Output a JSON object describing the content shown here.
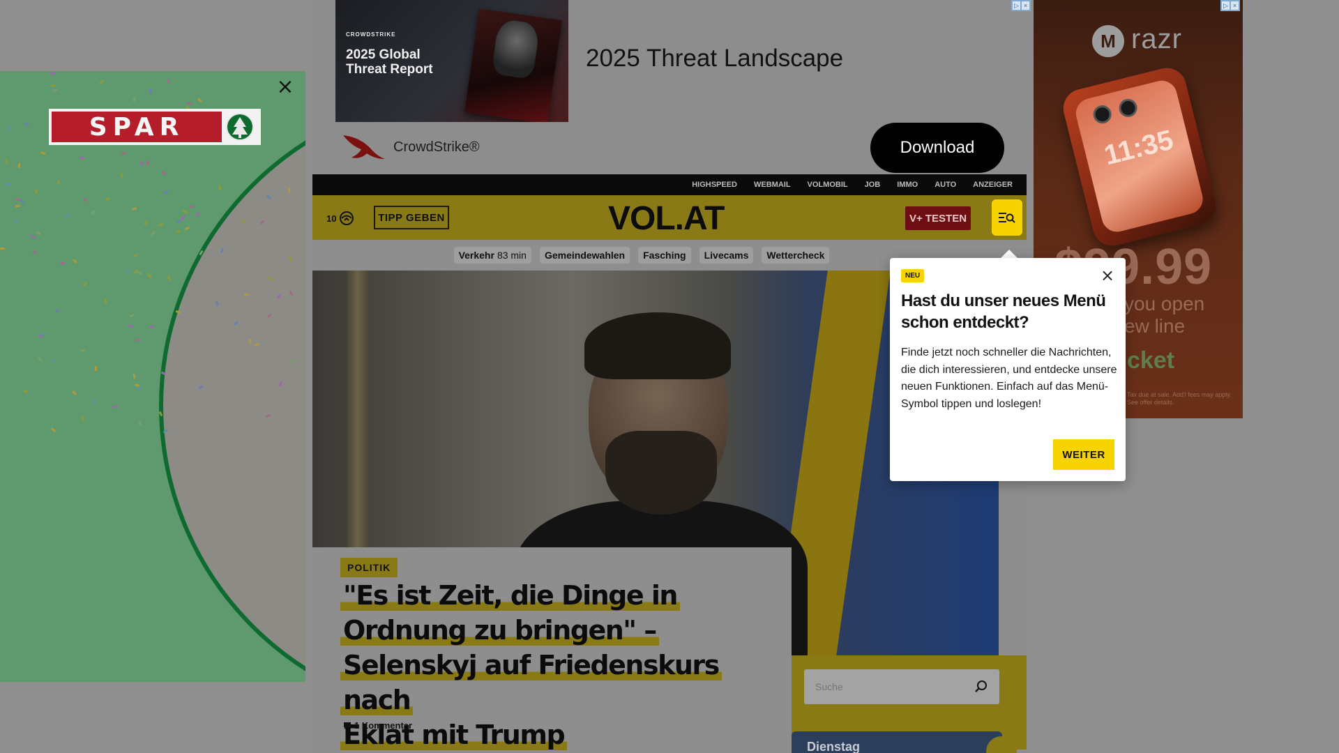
{
  "spar_ad": {
    "brand": "SPAR",
    "close": "×"
  },
  "top_ad": {
    "image_brand": "CROWDSTRIKE",
    "image_title": "2025 Global Threat Report",
    "title": "2025 Threat Landscape",
    "advertiser": "CrowdStrike®",
    "cta": "Download"
  },
  "right_ad": {
    "brand": "razr",
    "screen_time": "11:35",
    "price": "$99.99",
    "line1": "you open",
    "line2": "ew line",
    "carrier": "cket",
    "fine_print": "Tax due at sale. Add'l fees may apply. See offer details."
  },
  "topnav": {
    "items": [
      "HIGHSPEED",
      "WEBMAIL",
      "VOLMOBIL",
      "JOB",
      "IMMO",
      "AUTO",
      "ANZEIGER"
    ]
  },
  "header": {
    "weather_temp": "10",
    "tip_button": "TIPP GEBEN",
    "logo": "VOL.AT",
    "vplus_button": "V+ TESTEN"
  },
  "quicklinks": {
    "traffic_label": "Verkehr",
    "traffic_value": "83 min",
    "items": [
      "Gemeindewahlen",
      "Fasching",
      "Livecams",
      "Wettercheck"
    ]
  },
  "article": {
    "category": "POLITIK",
    "headline_lines": [
      "\"Es ist Zeit, die Dinge in",
      "Ordnung zu bringen\" –",
      "Selenskyj auf Friedenskurs nach",
      "Eklat mit Trump"
    ],
    "comments": "1 Kommentar"
  },
  "sidebar": {
    "search_placeholder": "Suche",
    "day": "Dienstag"
  },
  "popover": {
    "badge": "NEU",
    "title": "Hast du unser neues Menü schon entdeckt?",
    "text": "Finde jetzt noch schneller die Nachrichten, die dich interessieren, und entdecke unsere neuen Funktionen. Einfach auf das Menü-Symbol tippen und loslegen!",
    "button": "WEITER",
    "close": "×"
  },
  "colors": {
    "brand_yellow": "#f7d300",
    "vplus_red": "#c8102e",
    "spar_red": "#d8232f",
    "spar_green": "#0f6a30",
    "overlay": "rgba(0,0,0,0.45)"
  }
}
